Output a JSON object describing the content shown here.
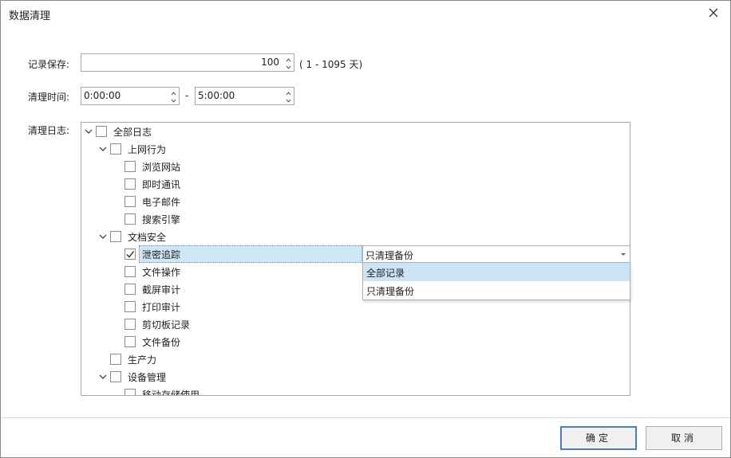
{
  "window": {
    "title": "数据清理"
  },
  "retention": {
    "label": "记录保存:",
    "value": "100",
    "hint": "( 1 - 1095  天)"
  },
  "clean_time": {
    "label": "清理时间:",
    "start": "0:00:00",
    "separator": "-",
    "end": "5:00:00"
  },
  "log": {
    "label": "清理日志:",
    "tree": [
      {
        "text": "全部日志",
        "checked": false,
        "expandable": true
      },
      {
        "text": "上网行为",
        "checked": false,
        "expandable": true
      },
      {
        "text": "浏览网站",
        "checked": false
      },
      {
        "text": "即时通讯",
        "checked": false
      },
      {
        "text": "电子邮件",
        "checked": false
      },
      {
        "text": "搜索引擎",
        "checked": false
      },
      {
        "text": "文档安全",
        "checked": false,
        "expandable": true
      },
      {
        "text": "泄密追踪",
        "checked": true,
        "selected": true,
        "combo_value": "只清理备份"
      },
      {
        "text": "文件操作",
        "checked": false
      },
      {
        "text": "截屏审计",
        "checked": false
      },
      {
        "text": "打印审计",
        "checked": false
      },
      {
        "text": "剪切板记录",
        "checked": false
      },
      {
        "text": "文件备份",
        "checked": false
      },
      {
        "text": "生产力",
        "checked": false
      },
      {
        "text": "设备管理",
        "checked": false,
        "expandable": true
      },
      {
        "text": "移动存储使用",
        "checked": false
      }
    ],
    "dropdown_options": [
      "全部记录",
      "只清理备份"
    ],
    "dropdown_highlight": "全部记录"
  },
  "buttons": {
    "ok": "确定",
    "cancel": "取消"
  },
  "colors": {
    "selection": "#cfe6f7",
    "primary_border": "#4a7fc1"
  }
}
